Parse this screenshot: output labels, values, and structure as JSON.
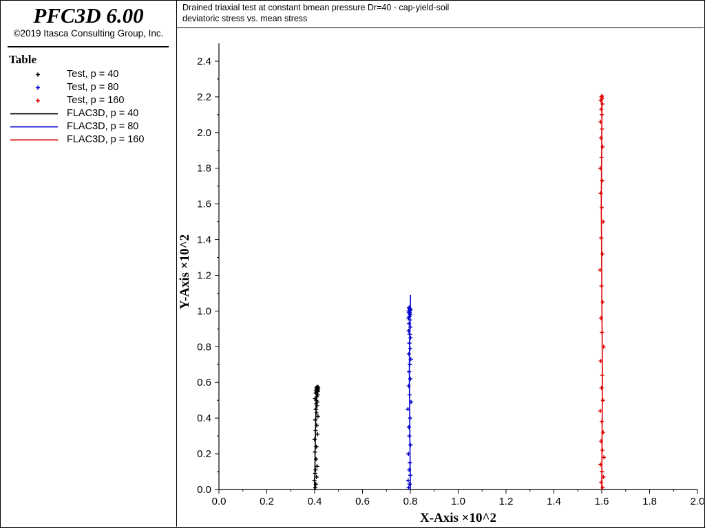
{
  "app": {
    "product": "PFC3D 6.00",
    "copyright": "©2019 Itasca Consulting Group, Inc."
  },
  "legend": {
    "title": "Table",
    "items": [
      {
        "label": "Test, p = 40",
        "kind": "marker",
        "color": "#000000"
      },
      {
        "label": "Test, p = 80",
        "kind": "marker",
        "color": "#0000cc"
      },
      {
        "label": "Test, p = 160",
        "kind": "marker",
        "color": "#dd0000"
      },
      {
        "label": "FLAC3D, p = 40",
        "kind": "line",
        "color": "#000000"
      },
      {
        "label": "FLAC3D, p = 80",
        "kind": "line",
        "color": "#0000cc"
      },
      {
        "label": "FLAC3D, p = 160",
        "kind": "line",
        "color": "#dd0000"
      }
    ]
  },
  "header": {
    "line1": "Drained triaxial test at constant bmean pressure Dr=40 - cap-yield-soil",
    "line2": "deviatoric stress vs. mean stress"
  },
  "chart_data": {
    "type": "scatter",
    "title": "",
    "xlabel": "X-Axis ×10^2",
    "ylabel": "Y-Axis ×10^2",
    "xlim": [
      0,
      2.0
    ],
    "ylim": [
      0,
      2.5
    ],
    "xticks": [
      "0.0",
      "0.2",
      "0.4",
      "0.6",
      "0.8",
      "1.0",
      "1.2",
      "1.4",
      "1.6",
      "1.8",
      "2.0"
    ],
    "yticks": [
      "0.0",
      "0.2",
      "0.4",
      "0.6",
      "0.8",
      "1.0",
      "1.2",
      "1.4",
      "1.6",
      "1.8",
      "2.0",
      "2.2",
      "2.4"
    ],
    "grid": false,
    "legend_placement": "left-panel",
    "series": [
      {
        "name": "Test, p = 40",
        "kind": "marker",
        "color": "#000000",
        "x": [
          0.403,
          0.405,
          0.399,
          0.408,
          0.402,
          0.404,
          0.41,
          0.406,
          0.401,
          0.407,
          0.4,
          0.412,
          0.404,
          0.409,
          0.403,
          0.414,
          0.408,
          0.405,
          0.41,
          0.406,
          0.411,
          0.407,
          0.402,
          0.409,
          0.413,
          0.405,
          0.408,
          0.41,
          0.406,
          0.412,
          0.409,
          0.411,
          0.414,
          0.41,
          0.413,
          0.408,
          0.412,
          0.415,
          0.41
        ],
        "y": [
          0.01,
          0.03,
          0.05,
          0.07,
          0.09,
          0.11,
          0.13,
          0.17,
          0.21,
          0.24,
          0.28,
          0.31,
          0.33,
          0.36,
          0.39,
          0.41,
          0.43,
          0.45,
          0.47,
          0.48,
          0.49,
          0.5,
          0.51,
          0.52,
          0.53,
          0.54,
          0.545,
          0.55,
          0.555,
          0.56,
          0.565,
          0.57,
          0.575,
          0.56,
          0.55,
          0.57,
          0.555,
          0.565,
          0.575
        ]
      },
      {
        "name": "Test, p = 80",
        "kind": "marker",
        "color": "#0000cc",
        "x": [
          0.793,
          0.797,
          0.791,
          0.8,
          0.795,
          0.798,
          0.792,
          0.801,
          0.796,
          0.794,
          0.799,
          0.79,
          0.803,
          0.797,
          0.793,
          0.8,
          0.795,
          0.798,
          0.802,
          0.794,
          0.799,
          0.796,
          0.801,
          0.797,
          0.793,
          0.8,
          0.795,
          0.798,
          0.792,
          0.796,
          0.799,
          0.794,
          0.797,
          0.801,
          0.795,
          0.798,
          0.793,
          0.8,
          0.796,
          0.799
        ],
        "y": [
          0.01,
          0.03,
          0.05,
          0.08,
          0.11,
          0.15,
          0.2,
          0.25,
          0.3,
          0.35,
          0.4,
          0.45,
          0.49,
          0.53,
          0.58,
          0.62,
          0.66,
          0.7,
          0.73,
          0.76,
          0.79,
          0.82,
          0.85,
          0.87,
          0.89,
          0.91,
          0.93,
          0.95,
          0.96,
          0.97,
          0.98,
          0.99,
          1.0,
          1.01,
          1.02,
          0.99,
          1.0,
          1.01,
          1.015,
          1.005
        ]
      },
      {
        "name": "Test, p = 160",
        "kind": "marker",
        "color": "#dd0000",
        "x": [
          1.604,
          1.598,
          1.607,
          1.601,
          1.595,
          1.609,
          1.603,
          1.597,
          1.606,
          1.6,
          1.594,
          1.605,
          1.599,
          1.602,
          1.596,
          1.608,
          1.601,
          1.597,
          1.604,
          1.599,
          1.593,
          1.603,
          1.598,
          1.606,
          1.6,
          1.596,
          1.602,
          1.594,
          1.599,
          1.604,
          1.597,
          1.601,
          1.595,
          1.6,
          1.598,
          1.603,
          1.596,
          1.602,
          1.599,
          1.601
        ],
        "y": [
          0.01,
          0.04,
          0.07,
          0.1,
          0.14,
          0.18,
          0.22,
          0.27,
          0.32,
          0.38,
          0.44,
          0.5,
          0.57,
          0.64,
          0.72,
          0.8,
          0.88,
          0.96,
          1.05,
          1.14,
          1.23,
          1.32,
          1.41,
          1.5,
          1.58,
          1.66,
          1.73,
          1.8,
          1.86,
          1.92,
          1.97,
          2.02,
          2.06,
          2.1,
          2.13,
          2.16,
          2.18,
          2.19,
          2.2,
          2.205
        ]
      },
      {
        "name": "FLAC3D, p = 40",
        "kind": "line",
        "color": "#000000",
        "x": [
          0.4,
          0.401,
          0.402,
          0.403,
          0.404,
          0.405,
          0.406,
          0.407,
          0.408,
          0.409,
          0.41
        ],
        "y": [
          0.0,
          0.1,
          0.2,
          0.28,
          0.35,
          0.41,
          0.46,
          0.5,
          0.53,
          0.55,
          0.565
        ]
      },
      {
        "name": "FLAC3D, p = 80",
        "kind": "line",
        "color": "#0000cc",
        "x": [
          0.8,
          0.799,
          0.798,
          0.797,
          0.796,
          0.796,
          0.797,
          0.798,
          0.799,
          0.8,
          0.801
        ],
        "y": [
          0.0,
          0.15,
          0.3,
          0.45,
          0.6,
          0.72,
          0.82,
          0.9,
          0.96,
          1.01,
          1.09
        ]
      },
      {
        "name": "FLAC3D, p = 160",
        "kind": "line",
        "color": "#dd0000",
        "x": [
          1.6,
          1.601,
          1.602,
          1.603,
          1.602,
          1.601,
          1.6,
          1.599,
          1.598,
          1.599,
          1.6,
          1.601,
          1.6
        ],
        "y": [
          0.0,
          0.2,
          0.4,
          0.6,
          0.8,
          1.0,
          1.2,
          1.4,
          1.6,
          1.8,
          1.95,
          2.1,
          2.2
        ]
      }
    ]
  }
}
